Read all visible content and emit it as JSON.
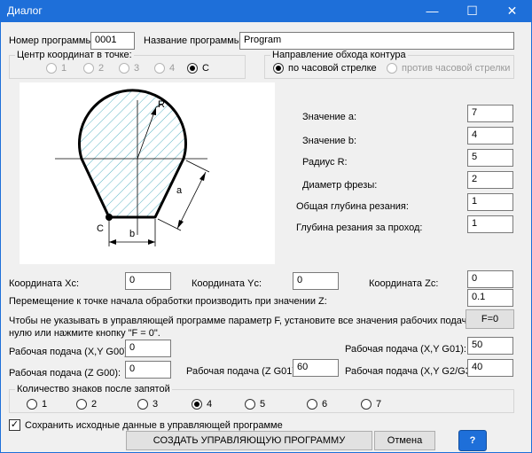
{
  "window": {
    "title": "Диалог",
    "minimize": "—",
    "maximize": "☐",
    "close": "✕"
  },
  "header": {
    "program_number_label": "Номер программы:",
    "program_number_value": "0001",
    "program_name_label": "Название программы:",
    "program_name_value": "Program"
  },
  "center_group": {
    "title": "Центр координат в точке:",
    "options": [
      "1",
      "2",
      "3",
      "4",
      "C"
    ],
    "selected": "C"
  },
  "direction_group": {
    "title": "Направление обхода контура",
    "options": [
      "по часовой стрелке",
      "против часовой стрелки"
    ],
    "selected": "по часовой стрелке"
  },
  "drawing": {
    "label_r": "R",
    "label_a": "a",
    "label_b": "b",
    "label_c": "C"
  },
  "params": [
    {
      "label": "Значение a:",
      "value": "7"
    },
    {
      "label": "Значение b:",
      "value": "4"
    },
    {
      "label": "Радиус R:",
      "value": "5"
    },
    {
      "label": "Диаметр фрезы:",
      "value": "2"
    },
    {
      "label": "Общая глубина резания:",
      "value": "1"
    },
    {
      "label": "Глубина резания за проход:",
      "value": "1"
    }
  ],
  "coords": {
    "xc_label": "Координата Xc:",
    "xc_value": "0",
    "yc_label": "Координата Yc:",
    "yc_value": "0",
    "zc_label": "Координата Zc:",
    "zc_value": "0"
  },
  "approach": {
    "label": "Перемещение к точке начала обработки производить при значении Z:",
    "value": "0.1"
  },
  "f_note": {
    "line1": "Чтобы не указывать в управляющей программе параметр F, установите все значения рабочих подач равными",
    "line2": "нулю или нажмите кнопку \"F = 0\".",
    "button": "F=0"
  },
  "feeds": {
    "g00_xy_label": "Рабочая подача (X,Y G00):",
    "g00_xy_value": "0",
    "g00_z_label": "Рабочая подача (Z G00):",
    "g00_z_value": "0",
    "g01_z_label": "Рабочая подача (Z G01):",
    "g01_z_value": "60",
    "g01_xy_label": "Рабочая подача (X,Y G01):",
    "g01_xy_value": "50",
    "g23_xy_label": "Рабочая подача (X,Y G2/G3):",
    "g23_xy_value": "40"
  },
  "decimals_group": {
    "title": "Количество знаков после запятой",
    "options": [
      "1",
      "2",
      "3",
      "4",
      "5",
      "6",
      "7"
    ],
    "selected": "4"
  },
  "save_check": {
    "label": "Сохранить исходные данные в управляющей программе",
    "checked": true,
    "mark": "✓"
  },
  "buttons": {
    "create": "СОЗДАТЬ УПРАВЛЯЮЩУЮ ПРОГРАММУ",
    "cancel": "Отмена",
    "help": "?"
  },
  "colors": {
    "titlebar": "#1e6fd9",
    "help_button": "#1e6fd9",
    "hatch": "#5ab4c4"
  }
}
